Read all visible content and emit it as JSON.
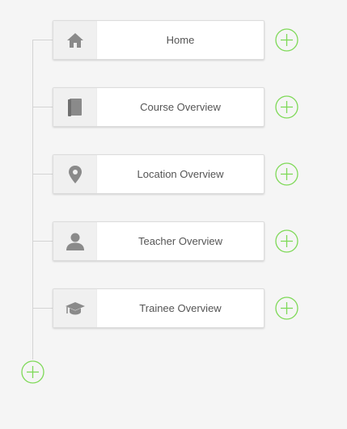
{
  "colors": {
    "accent": "#7ed957",
    "icon": "#8a8a8a",
    "text": "#555555",
    "line": "#d4d4d4"
  },
  "nav": {
    "items": [
      {
        "label": "Home",
        "icon": "home-icon"
      },
      {
        "label": "Course Overview",
        "icon": "book-icon"
      },
      {
        "label": "Location Overview",
        "icon": "map-pin-icon"
      },
      {
        "label": "Teacher Overview",
        "icon": "person-icon"
      },
      {
        "label": "Trainee Overview",
        "icon": "graduation-cap-icon"
      }
    ]
  }
}
